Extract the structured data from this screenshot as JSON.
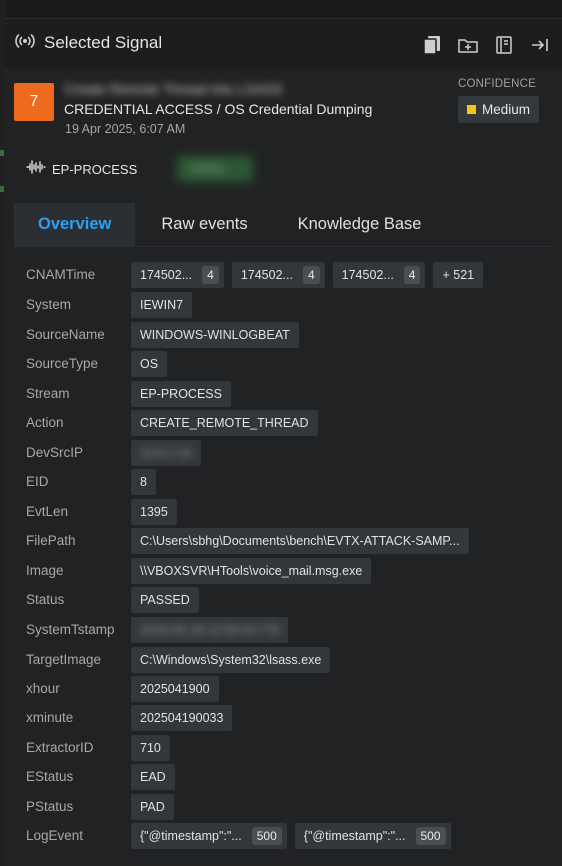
{
  "header": {
    "title": "Selected Signal",
    "icons": [
      "copy-icon",
      "folder-add-icon",
      "notebook-icon",
      "collapse-panel-icon"
    ]
  },
  "signal": {
    "severity": "7",
    "name": "Create Remote Thread into LSASS",
    "tactic": "CREDENTIAL ACCESS / OS Credential Dumping",
    "timestamp": "19 Apr 2025, 6:07 AM",
    "confidence_label": "CONFIDENCE",
    "confidence": "Medium",
    "severity_color": "#ee6a1f",
    "confidence_color": "#f5c518"
  },
  "stream": {
    "label": "EP-PROCESS",
    "status": "Active"
  },
  "tabs": [
    {
      "label": "Overview",
      "active": true
    },
    {
      "label": "Raw events",
      "active": false
    },
    {
      "label": "Knowledge Base",
      "active": false
    }
  ],
  "fields": [
    {
      "key": "CNAMTime",
      "values": [
        {
          "text": "174502...",
          "count": "4"
        },
        {
          "text": "174502...",
          "count": "4"
        },
        {
          "text": "174502...",
          "count": "4"
        },
        {
          "text": "+ 521"
        }
      ]
    },
    {
      "key": "System",
      "values": [
        {
          "text": "IEWIN7"
        }
      ]
    },
    {
      "key": "SourceName",
      "values": [
        {
          "text": "WINDOWS-WINLOGBEAT"
        }
      ]
    },
    {
      "key": "SourceType",
      "values": [
        {
          "text": "OS"
        }
      ]
    },
    {
      "key": "Stream",
      "values": [
        {
          "text": "EP-PROCESS"
        }
      ]
    },
    {
      "key": "Action",
      "values": [
        {
          "text": "CREATE_REMOTE_THREAD"
        }
      ]
    },
    {
      "key": "DevSrcIP",
      "values": [
        {
          "text": "10.0.2.15",
          "blurred": true
        }
      ]
    },
    {
      "key": "EID",
      "values": [
        {
          "text": "8"
        }
      ]
    },
    {
      "key": "EvtLen",
      "values": [
        {
          "text": "1395"
        }
      ]
    },
    {
      "key": "FilePath",
      "values": [
        {
          "text": "C:\\Users\\sbhg\\Documents\\bench\\EVTX-ATTACK-SAMP..."
        }
      ]
    },
    {
      "key": "Image",
      "values": [
        {
          "text": "\\\\VBOXSVR\\HTools\\voice_mail.msg.exe"
        }
      ]
    },
    {
      "key": "Status",
      "values": [
        {
          "text": "PASSED"
        }
      ]
    },
    {
      "key": "SystemTstamp",
      "values": [
        {
          "text": "2019-05-18 11:59:43.776",
          "blurred": true
        }
      ]
    },
    {
      "key": "TargetImage",
      "values": [
        {
          "text": "C:\\Windows\\System32\\lsass.exe"
        }
      ]
    },
    {
      "key": "xhour",
      "values": [
        {
          "text": "2025041900"
        }
      ]
    },
    {
      "key": "xminute",
      "values": [
        {
          "text": "202504190033"
        }
      ]
    },
    {
      "key": "ExtractorID",
      "values": [
        {
          "text": "710"
        }
      ]
    },
    {
      "key": "EStatus",
      "values": [
        {
          "text": "EAD"
        }
      ]
    },
    {
      "key": "PStatus",
      "values": [
        {
          "text": "PAD"
        }
      ]
    },
    {
      "key": "LogEvent",
      "values": [
        {
          "text": "{\"@timestamp\":\"...",
          "count": "500"
        },
        {
          "text": "{\"@timestamp\":\"...",
          "count": "500"
        }
      ]
    }
  ]
}
